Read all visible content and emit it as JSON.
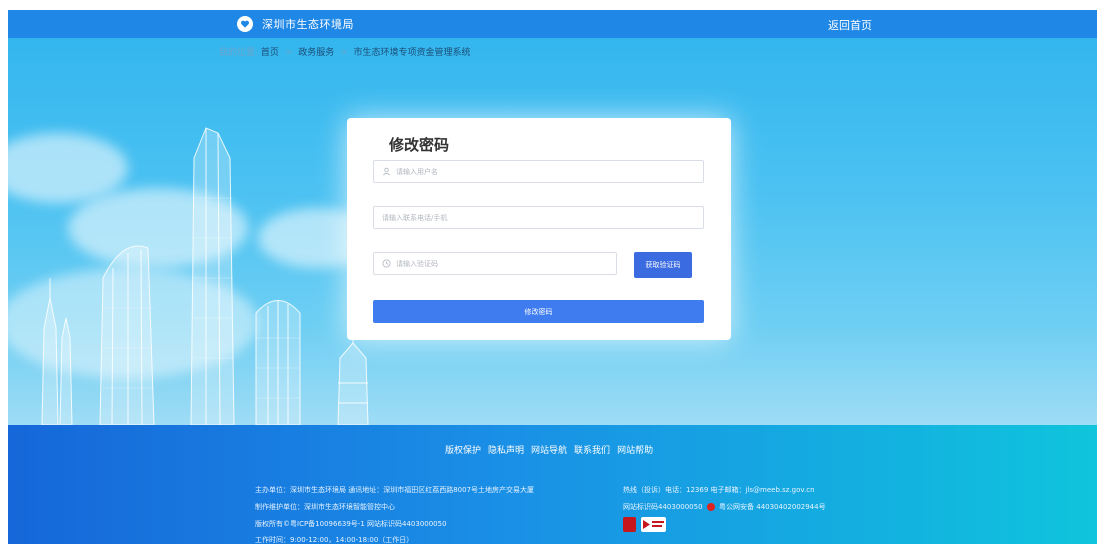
{
  "header": {
    "site_title": "深圳市生态环境局",
    "home_link": "返回首页"
  },
  "breadcrumb": {
    "label": "我的位置:",
    "items": [
      "首页",
      "政务服务",
      "市生态环境专项资金管理系统"
    ],
    "separator": ">"
  },
  "form": {
    "title": "修改密码",
    "username_placeholder": "请输入用户名",
    "phone_placeholder": "请输入联系电话/手机",
    "code_placeholder": "请输入验证码",
    "get_code_label": "获取验证码",
    "submit_label": "修改密码"
  },
  "footer": {
    "nav": [
      "版权保护",
      "隐私声明",
      "网站导航",
      "联系我们",
      "网站帮助"
    ],
    "sponsor": "主办单位：深圳市生态环境局  通讯地址：深圳市福田区红荔西路8007号土地房产交易大厦",
    "maintainer": "制作维护单位：深圳市生态环境智能管控中心",
    "copyright": "版权所有©粤ICP备10096639号-1 网站标识码4403000050",
    "hours": "工作时间：9:00-12:00，14:00-18:00（工作日）",
    "hotline": "热线（投诉）电话：12369  电子邮箱：jls@meeb.sz.gov.cn",
    "site_id_prefix": "网站标识码4403000050",
    "police_record": "粤公网安备 44030402002944号"
  },
  "colors": {
    "header_bg": "#1f87e6",
    "accent": "#3e7cf0",
    "footer_start": "#1667d9",
    "footer_end": "#0fc4dc"
  }
}
